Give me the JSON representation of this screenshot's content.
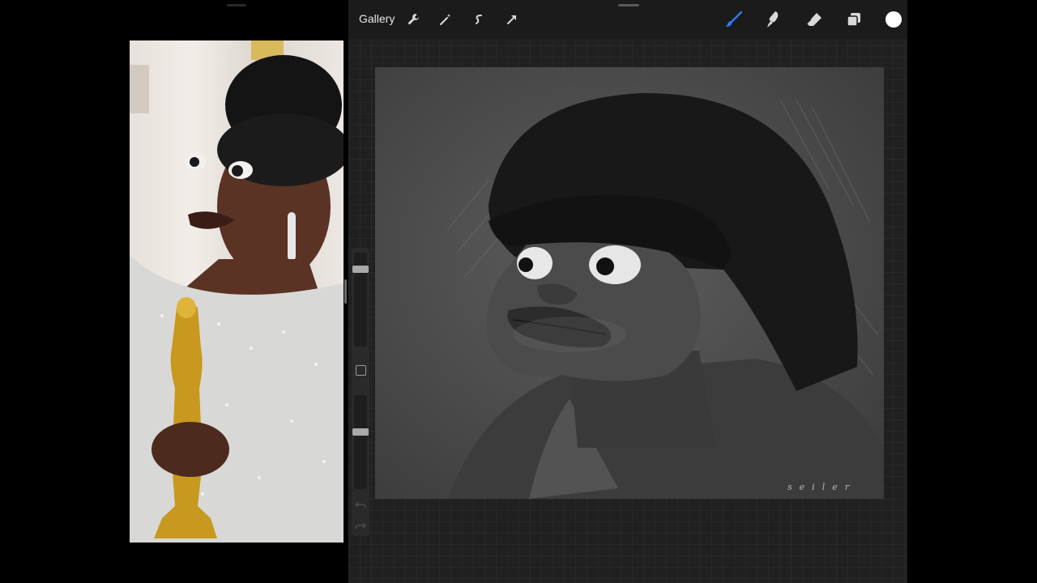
{
  "toolbar": {
    "gallery_label": "Gallery",
    "tools": [
      {
        "name": "actions-wrench-icon"
      },
      {
        "name": "adjustments-magic-wand-icon"
      },
      {
        "name": "selection-icon"
      },
      {
        "name": "transform-arrow-icon"
      },
      {
        "name": "brush-icon"
      },
      {
        "name": "smudge-icon"
      },
      {
        "name": "eraser-icon"
      },
      {
        "name": "layers-icon"
      }
    ],
    "active_tool": "brush",
    "current_color": "#ffffff",
    "accent_color": "#2f7bf5"
  },
  "sidebar": {
    "brush_size_level": 0.85,
    "opacity_level": 0.62
  },
  "canvas": {
    "signature": "seiler"
  },
  "reference": {
    "description_icon": "reference-photo"
  }
}
